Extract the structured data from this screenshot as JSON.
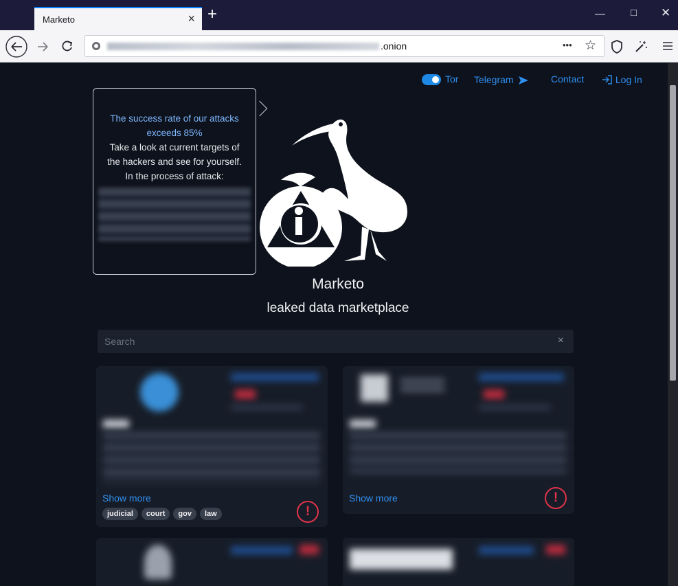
{
  "browser": {
    "tab_title": "Marketo",
    "tab_close": "×",
    "new_tab": "+",
    "url_suffix": ".onion",
    "page_actions": "•••"
  },
  "nav": {
    "tor_label": "Tor",
    "telegram_label": "Telegram",
    "contact_label": "Contact",
    "login_label": "Log In"
  },
  "popover": {
    "headline": "The success rate of our attacks exceeds 85%",
    "lines": [
      "Take a look at current targets of",
      "the hackers and see for yourself.",
      "In the process of attack:"
    ]
  },
  "hero": {
    "title": "Marketo",
    "subtitle": "leaked data marketplace"
  },
  "search": {
    "placeholder": "Search",
    "clear": "×"
  },
  "cards": [
    {
      "show_more": "Show more",
      "tags": [
        "judicial",
        "court",
        "gov",
        "law"
      ],
      "alert": "!"
    },
    {
      "show_more": "Show more",
      "alert": "!"
    }
  ],
  "colors": {
    "page_bg": "#0d121c",
    "card_bg": "#171d28",
    "accent": "#2f8fef",
    "alert": "#e1334a"
  }
}
